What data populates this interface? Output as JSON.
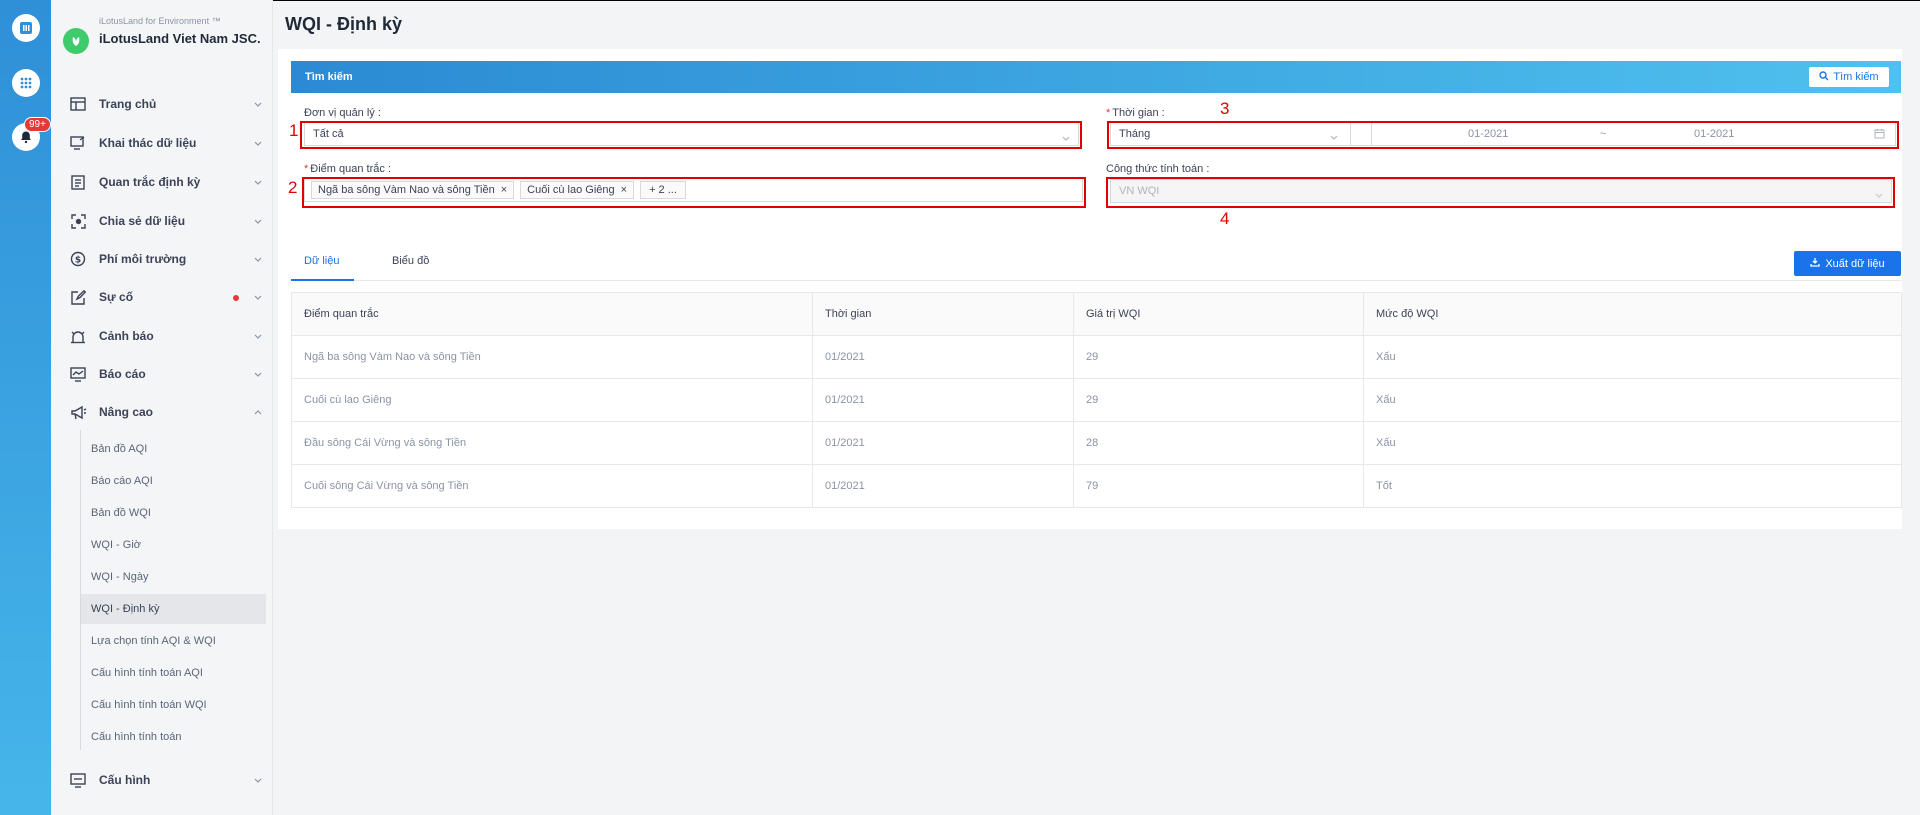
{
  "brand": {
    "sub": "iLotusLand for Environment ™",
    "name": "iLotusLand Viet Nam JSC."
  },
  "rail": {
    "badge": "99+"
  },
  "sidebar": {
    "items": [
      {
        "label": "Trang chủ",
        "icon": "home-layout-icon"
      },
      {
        "label": "Khai thác dữ liệu",
        "icon": "monitor-edit-icon"
      },
      {
        "label": "Quan trắc định kỳ",
        "icon": "document-list-icon"
      },
      {
        "label": "Chia sẻ dữ liệu",
        "icon": "share-focus-icon"
      },
      {
        "label": "Phí môi trường",
        "icon": "dollar-circle-icon"
      },
      {
        "label": "Sự cố",
        "icon": "edit-square-icon"
      },
      {
        "label": "Cảnh báo",
        "icon": "alarm-icon"
      },
      {
        "label": "Báo cáo",
        "icon": "report-monitor-icon"
      },
      {
        "label": "Nâng cao",
        "icon": "megaphone-icon"
      },
      {
        "label": "Cấu hình",
        "icon": "settings-monitor-icon"
      }
    ],
    "sub_items": [
      "Bản đồ AQI",
      "Báo cáo AQI",
      "Bản đồ WQI",
      "WQI - Giờ",
      "WQI - Ngày",
      "WQI - Định kỳ",
      "Lựa chọn tính AQI & WQI",
      "Cấu hình tính toán AQI",
      "Cấu hình tính toán WQI",
      "Cấu hình tính toán"
    ],
    "active_sub": "WQI - Định kỳ"
  },
  "page": {
    "title": "WQI - Định kỳ"
  },
  "search": {
    "title": "Tìm kiếm",
    "button": "Tìm kiếm",
    "unit_label": "Đơn vị quản lý :",
    "unit_value": "Tất cả",
    "time_label": "Thời gian :",
    "time_type": "Tháng",
    "time_from": "01-2021",
    "time_sep": "~",
    "time_to": "01-2021",
    "point_label": "Điểm quan trắc :",
    "point_tags": [
      "Ngã ba sông Vàm Nao và sông Tiền",
      "Cuối cù lao Giêng"
    ],
    "point_more": "+ 2 ...",
    "formula_label": "Công thức tính toán :",
    "formula_value": "VN WQI"
  },
  "callouts": [
    "1",
    "2",
    "3",
    "4"
  ],
  "tabs": {
    "data": "Dữ liệu",
    "chart": "Biểu đồ"
  },
  "export_button": "Xuất dữ liệu",
  "table": {
    "headers": [
      "Điểm quan trắc",
      "Thời gian",
      "Giá trị WQI",
      "Mức độ WQI"
    ],
    "rows": [
      [
        "Ngã ba sông Vàm Nao và sông Tiền",
        "01/2021",
        "29",
        "Xấu"
      ],
      [
        "Cuối cù lao Giêng",
        "01/2021",
        "29",
        "Xấu"
      ],
      [
        "Đầu sông Cái Vừng và sông Tiền",
        "01/2021",
        "28",
        "Xấu"
      ],
      [
        "Cuối sông Cái Vừng và sông Tiền",
        "01/2021",
        "79",
        "Tốt"
      ]
    ]
  }
}
